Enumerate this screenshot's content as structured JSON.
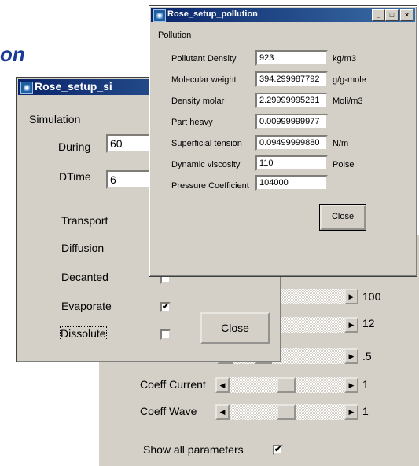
{
  "background": {
    "heading_fragment": "on"
  },
  "sim": {
    "title": "Rose_setup_si",
    "group": "Simulation",
    "during_label": "During",
    "during_value": "60",
    "dtime_label": "DTime",
    "dtime_value": "6",
    "transport": "Transport",
    "diffusion": "Diffusion",
    "decanted": "Decanted",
    "evaporate": "Evaporate",
    "dissolute": "Dissolute",
    "evaporate_checked": "✔",
    "close": "Close"
  },
  "params": {
    "row1_value": "100",
    "row2_value": "12",
    "row3_value": ".5",
    "coeff_current_label": "Coeff Current",
    "coeff_current_value": "1",
    "coeff_wave_label": "Coeff Wave",
    "coeff_wave_value": "1",
    "show_all_label": "Show all parameters",
    "show_all_checked": "✔"
  },
  "pollution": {
    "title": "Rose_setup_pollution",
    "group": "Pollution",
    "rows": [
      {
        "label": "Pollutant Density",
        "value": "923",
        "unit": "kg/m3"
      },
      {
        "label": "Molecular weight",
        "value": "394.299987792",
        "unit": "g/g-mole"
      },
      {
        "label": "Density molar",
        "value": "2.29999995231",
        "unit": "Moli/m3"
      },
      {
        "label": "Part heavy",
        "value": "0.00999999977",
        "unit": ""
      },
      {
        "label": "Superficial tension",
        "value": "0.09499999880",
        "unit": "N/m"
      },
      {
        "label": "Dynamic viscosity",
        "value": "110",
        "unit": "Poise"
      },
      {
        "label": "Pressure Coefficient",
        "value": "104000",
        "unit": ""
      }
    ],
    "close": "Close",
    "caption_buttons": {
      "minimize": "_",
      "maximize": "□",
      "close": "×"
    }
  },
  "icons": {
    "left_arrow": "◀",
    "right_arrow": "▶"
  },
  "colors": {
    "title_start": "#0a246a",
    "title_end": "#3a6ea5",
    "face": "#d4d0c8",
    "heading": "#1a3a9a"
  }
}
